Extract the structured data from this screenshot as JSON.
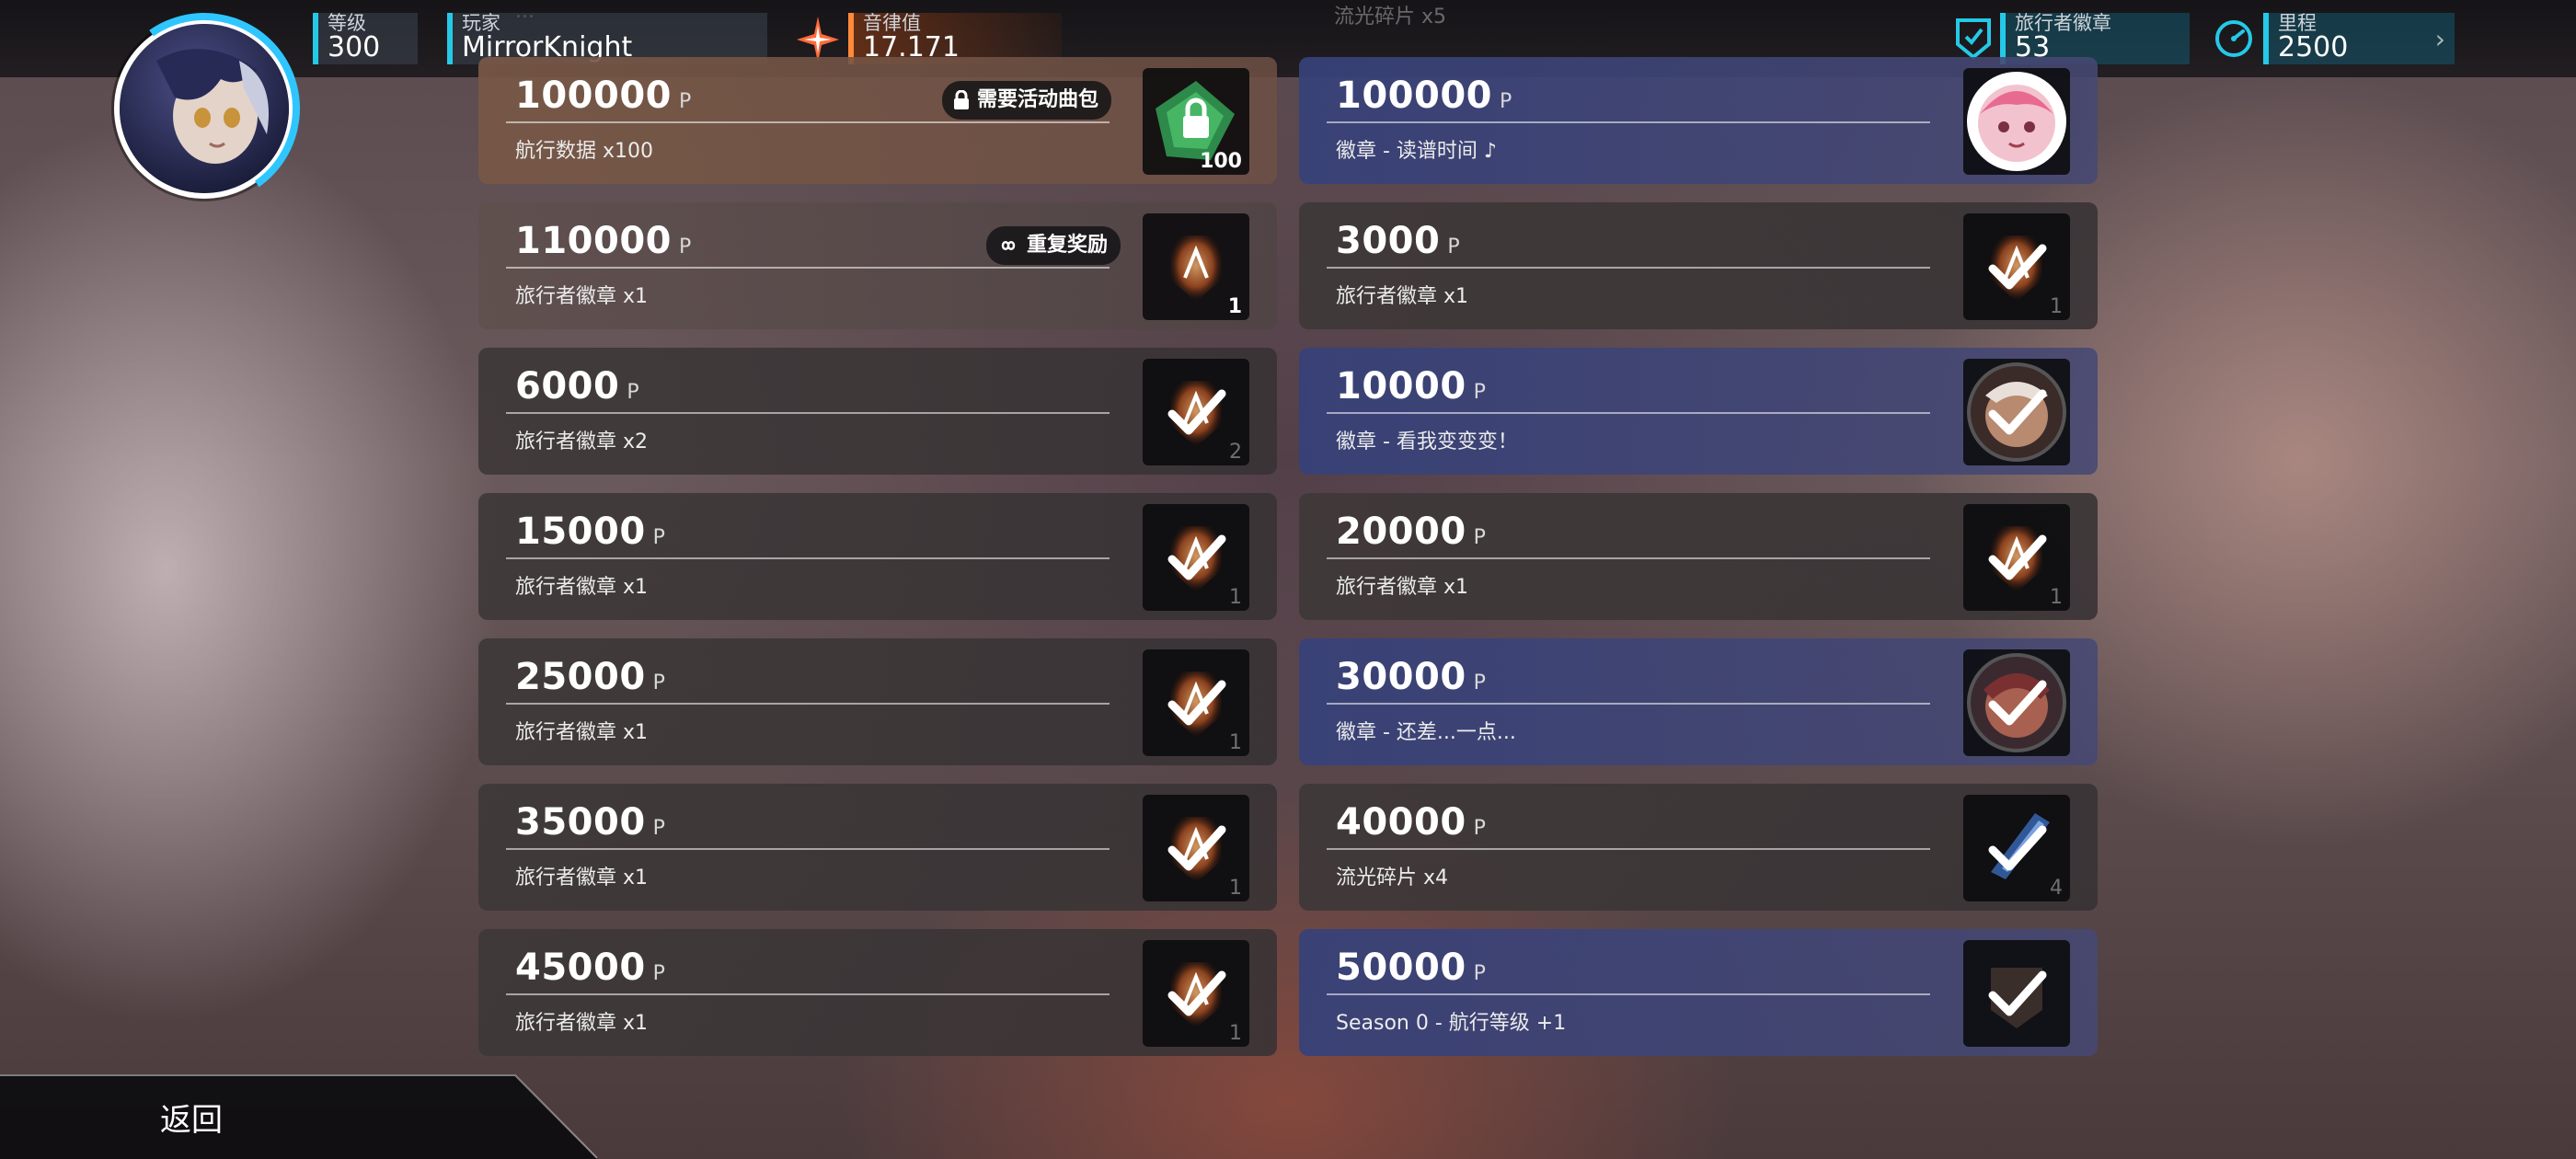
{
  "header": {
    "level_label": "等级",
    "level_value": "300",
    "player_label": "玩家",
    "player_value": "MirrorKnight",
    "rhythm_label": "音律值",
    "rhythm_value": "17.171",
    "badge_label": "旅行者徽章",
    "badge_value": "53",
    "mileage_label": "里程",
    "mileage_value": "2500"
  },
  "ghost_row": {
    "left": "...",
    "right": "流光碎片 x5",
    "right_count": "5"
  },
  "unit": "P",
  "left_cards": [
    {
      "points": "100000",
      "reward": "航行数据 x100",
      "tag": "需要活动曲包",
      "tag_icon": "lock-icon",
      "count": "100",
      "claimed": false,
      "item": "data-chip"
    },
    {
      "points": "110000",
      "reward": "旅行者徽章 x1",
      "tag": "重复奖励",
      "tag_icon": "infinity-icon",
      "count": "1",
      "claimed": false,
      "item": "badge"
    },
    {
      "points": "6000",
      "reward": "旅行者徽章 x2",
      "count": "2",
      "claimed": true,
      "item": "badge"
    },
    {
      "points": "15000",
      "reward": "旅行者徽章 x1",
      "count": "1",
      "claimed": true,
      "item": "badge"
    },
    {
      "points": "25000",
      "reward": "旅行者徽章 x1",
      "count": "1",
      "claimed": true,
      "item": "badge"
    },
    {
      "points": "35000",
      "reward": "旅行者徽章 x1",
      "count": "1",
      "claimed": true,
      "item": "badge"
    },
    {
      "points": "45000",
      "reward": "旅行者徽章 x1",
      "count": "1",
      "claimed": true,
      "item": "badge"
    }
  ],
  "right_cards": [
    {
      "points": "100000",
      "reward": "徽章 - 读谱时间 ♪",
      "count": "",
      "claimed": false,
      "item": "avatar-badge-pink"
    },
    {
      "points": "3000",
      "reward": "旅行者徽章 x1",
      "count": "1",
      "claimed": true,
      "item": "badge"
    },
    {
      "points": "10000",
      "reward": "徽章 - 看我变变变！",
      "count": "",
      "claimed": true,
      "item": "avatar-badge-brown"
    },
    {
      "points": "20000",
      "reward": "旅行者徽章 x1",
      "count": "1",
      "claimed": true,
      "item": "badge"
    },
    {
      "points": "30000",
      "reward": "徽章 - 还差...一点...",
      "count": "",
      "claimed": true,
      "item": "avatar-badge-red"
    },
    {
      "points": "40000",
      "reward": "流光碎片 x4",
      "count": "4",
      "claimed": true,
      "item": "shard"
    },
    {
      "points": "50000",
      "reward": "Season 0 - 航行等级 +1",
      "count": "",
      "claimed": true,
      "item": "season"
    }
  ],
  "footer": {
    "back_label": "返回"
  },
  "colors": {
    "accent_cyan": "#25c9e8",
    "accent_orange": "#ff8a3a",
    "card_blue": "#37417a"
  }
}
